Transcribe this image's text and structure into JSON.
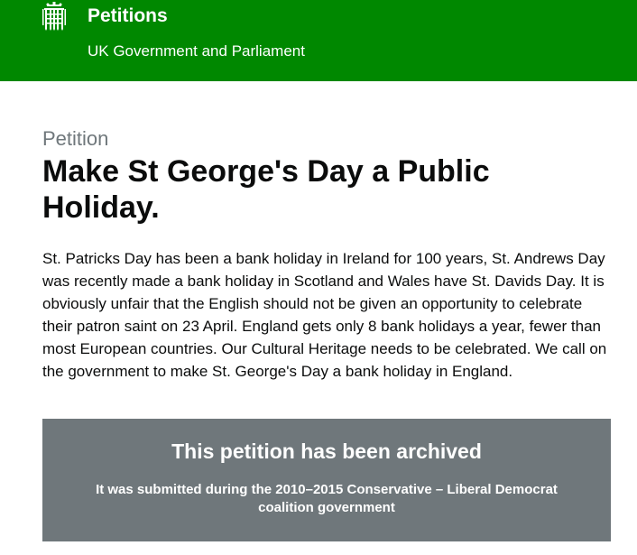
{
  "header": {
    "logo_icon": "portcullis-icon",
    "title": "Petitions",
    "subtitle": "UK Government and Parliament",
    "background_color": "#008800"
  },
  "petition": {
    "kicker": "Petition",
    "title": "Make St George's Day a Public Holiday.",
    "description": "St. Patricks Day has been a bank holiday in Ireland for 100 years, St. Andrews Day was recently made a bank holiday in Scotland and Wales have St. Davids Day. It is obviously unfair that the English should not be given an opportunity to celebrate their patron saint on 23 April. England gets only 8 bank holidays a year, fewer than most European countries. Our Cultural Heritage needs to be celebrated. We call on the government to make St. George's Day a bank holiday in England."
  },
  "archived_notice": {
    "title": "This petition has been archived",
    "text": "It was submitted during the 2010–2015 Conservative – Liberal Democrat coalition government",
    "background_color": "#6f777b"
  }
}
